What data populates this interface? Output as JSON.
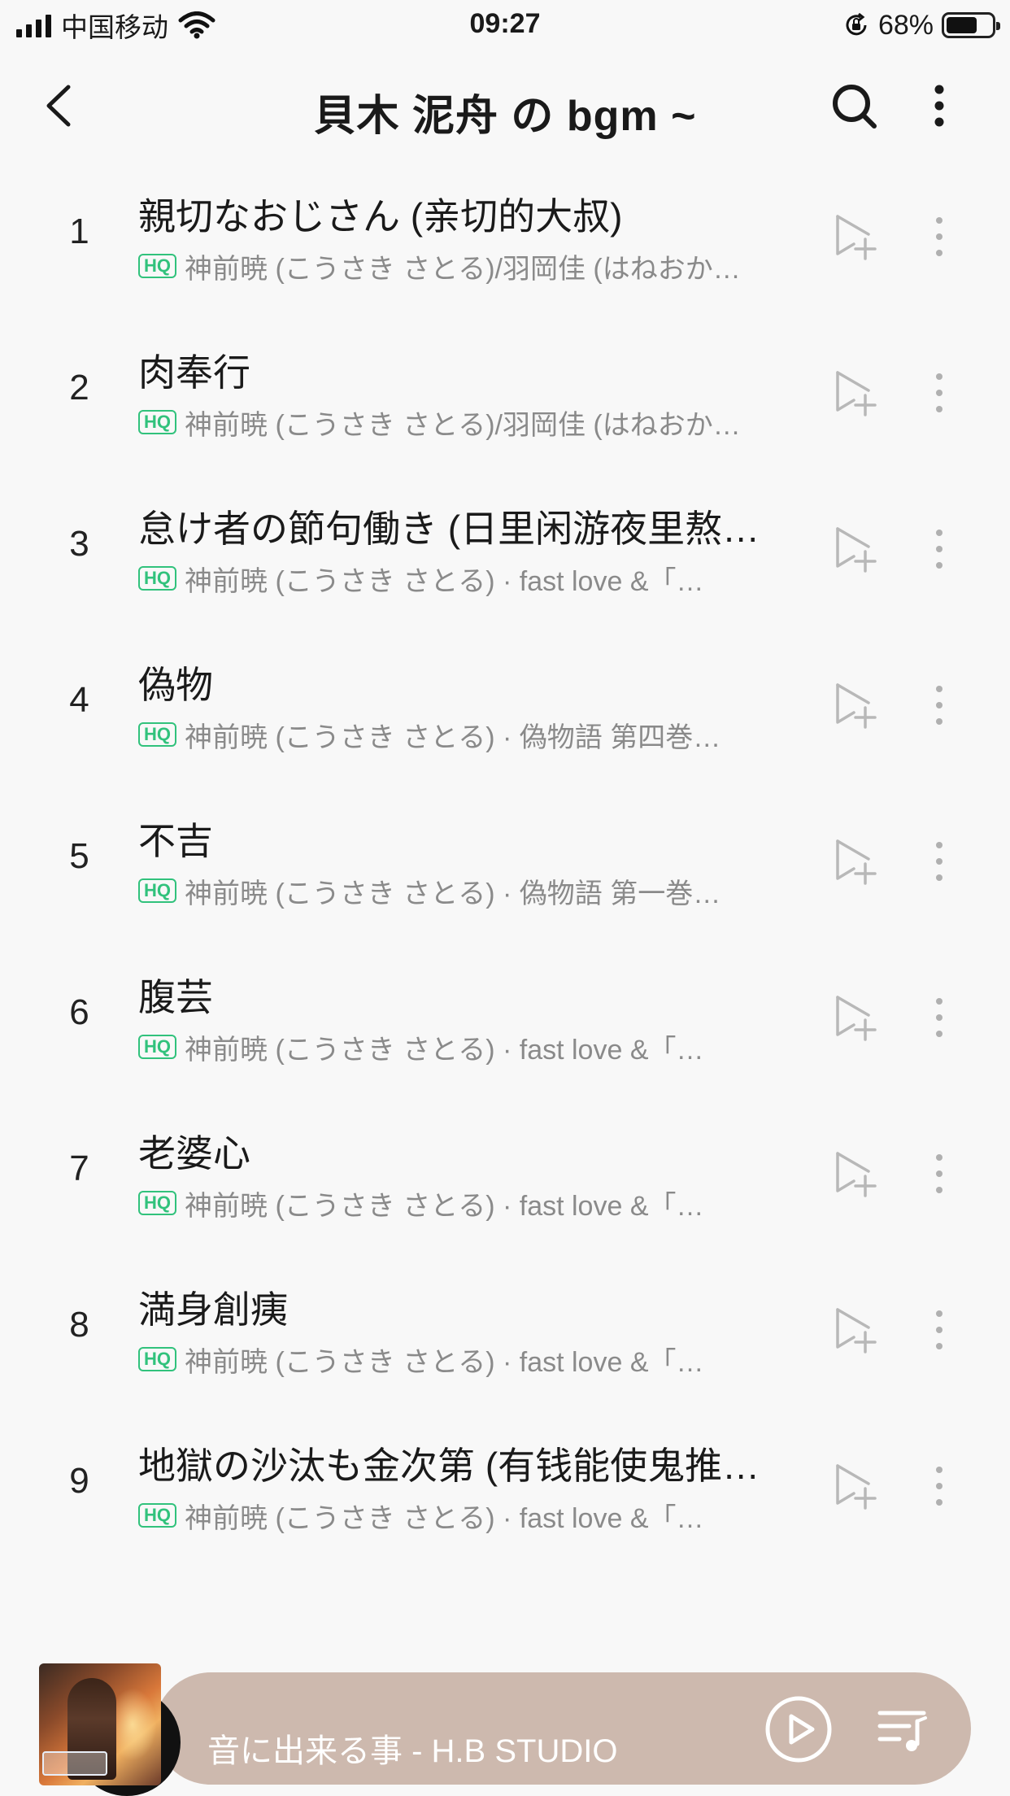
{
  "status_bar": {
    "carrier": "中国移动",
    "time": "09:27",
    "battery_percent": "68%",
    "battery_level": 0.68
  },
  "nav": {
    "title": "貝木 泥舟 の bgm ~",
    "back_icon": "chevron-left-icon",
    "search_icon": "search-icon",
    "more_icon": "more-vertical-icon"
  },
  "badge": "HQ",
  "songs": [
    {
      "index": "1",
      "title": "親切なおじさん (亲切的大叔)",
      "artist": "神前暁 (こうさき さとる)/羽岡佳 (はねおか…"
    },
    {
      "index": "2",
      "title": "肉奉行",
      "artist": "神前暁 (こうさき さとる)/羽岡佳 (はねおか…"
    },
    {
      "index": "3",
      "title": "怠け者の節句働き (日里闲游夜里熬…",
      "artist": "神前暁 (こうさき さとる) · fast love &「…"
    },
    {
      "index": "4",
      "title": "偽物",
      "artist": "神前暁 (こうさき さとる) · 偽物語 第四巻…"
    },
    {
      "index": "5",
      "title": "不吉",
      "artist": "神前暁 (こうさき さとる) · 偽物語 第一巻…"
    },
    {
      "index": "6",
      "title": "腹芸",
      "artist": "神前暁 (こうさき さとる) · fast love &「…"
    },
    {
      "index": "7",
      "title": "老婆心",
      "artist": "神前暁 (こうさき さとる) · fast love &「…"
    },
    {
      "index": "8",
      "title": "満身創痍",
      "artist": "神前暁 (こうさき さとる) · fast love &「…"
    },
    {
      "index": "9",
      "title": "地獄の沙汰も金次第 (有钱能使鬼推…",
      "artist": "神前暁 (こうさき さとる) · fast love &「…"
    }
  ],
  "mini_player": {
    "now_playing": "音に出来る事 - H.B STUDIO",
    "bar_color": "#cdb9ae",
    "play_icon": "play-circle-icon",
    "playlist_icon": "playlist-icon"
  },
  "colors": {
    "hq_green": "#31c27c",
    "subtitle_gray": "#8a8a8a",
    "background": "#f8f8f8"
  }
}
